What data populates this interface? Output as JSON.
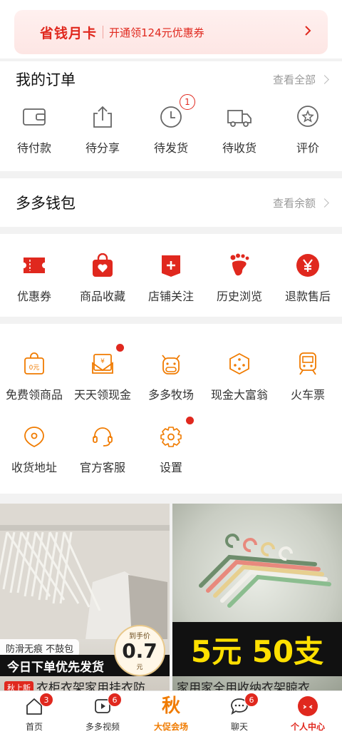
{
  "monthly_card": {
    "title": "省钱月卡",
    "subtitle": "开通领124元优惠券"
  },
  "orders": {
    "title": "我的订单",
    "link": "查看全部",
    "items": [
      {
        "label": "待付款",
        "icon": "wallet-icon"
      },
      {
        "label": "待分享",
        "icon": "share-icon"
      },
      {
        "label": "待发货",
        "icon": "clock-icon",
        "badge": "1"
      },
      {
        "label": "待收货",
        "icon": "truck-icon"
      },
      {
        "label": "评价",
        "icon": "star-bubble-icon"
      }
    ]
  },
  "wallet": {
    "title": "多多钱包",
    "link": "查看余额"
  },
  "quick": {
    "items": [
      {
        "label": "优惠券",
        "icon": "coupon-icon"
      },
      {
        "label": "商品收藏",
        "icon": "heart-bag-icon"
      },
      {
        "label": "店铺关注",
        "icon": "store-plus-icon"
      },
      {
        "label": "历史浏览",
        "icon": "footprint-icon"
      },
      {
        "label": "退款售后",
        "icon": "yen-circle-icon"
      }
    ]
  },
  "services": {
    "row1": [
      {
        "label": "免费领商品",
        "icon": "free-bag-icon"
      },
      {
        "label": "天天领现金",
        "icon": "cash-envelope-icon",
        "dot": true
      },
      {
        "label": "多多牧场",
        "icon": "cow-icon"
      },
      {
        "label": "现金大富翁",
        "icon": "dice-icon"
      },
      {
        "label": "火车票",
        "icon": "train-icon"
      }
    ],
    "row2": [
      {
        "label": "收货地址",
        "icon": "location-icon"
      },
      {
        "label": "官方客服",
        "icon": "headset-icon"
      },
      {
        "label": "设置",
        "icon": "gear-icon",
        "dot": true
      }
    ]
  },
  "products": [
    {
      "tag": "防滑无痕 不鼓包",
      "bar": "今日下单优先发货",
      "price_label": "到手价",
      "price": "0.7",
      "price_unit": "元",
      "new_tag": "秋上新",
      "title": "衣柜衣架家用挂衣防"
    },
    {
      "big_text": "5元 50支",
      "title": "家用家全用收纳衣架晾衣"
    }
  ],
  "tabbar": [
    {
      "label": "首页",
      "icon": "home-icon",
      "badge": "3"
    },
    {
      "label": "多多视频",
      "icon": "video-icon",
      "badge": "6"
    },
    {
      "label": "大促会场",
      "icon": "autumn-promo-icon",
      "glyph": "秋"
    },
    {
      "label": "聊天",
      "icon": "chat-icon",
      "badge": "6"
    },
    {
      "label": "个人中心",
      "icon": "profile-icon"
    }
  ],
  "colors": {
    "accent": "#e0281e",
    "orange": "#f07b00"
  }
}
